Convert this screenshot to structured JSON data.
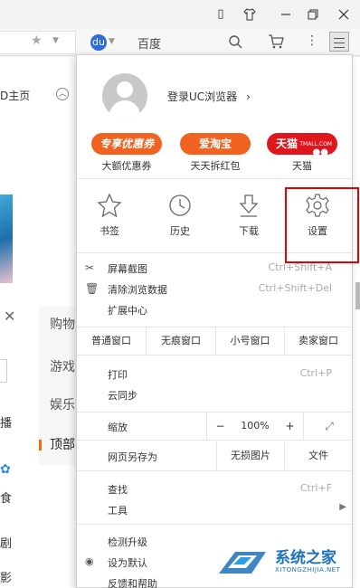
{
  "titlebar": {
    "icons": [
      "phone-icon",
      "shirt-icon",
      "minimize-icon",
      "restore-icon",
      "close-icon"
    ]
  },
  "toolbar": {
    "search_engine": "百度",
    "baidu_icon": "du",
    "icons": [
      "star-icon",
      "chevron-down-icon",
      "search-icon",
      "cart-icon",
      "more-icon",
      "menu-icon"
    ]
  },
  "background_page": {
    "home_link": "D主页",
    "side_items": [
      "购物",
      "游戏",
      "娱乐",
      "顶部"
    ],
    "left_texts": [
      "播",
      "食",
      "剧",
      "影"
    ]
  },
  "menu": {
    "login": "登录UC浏览器",
    "login_chevron": "›",
    "promos": [
      {
        "pill": "专享优惠券",
        "label": "大额优惠券",
        "color": "#f0621f"
      },
      {
        "pill": "爱淘宝",
        "label": "天天拆红包",
        "color": "#f0621f"
      },
      {
        "pill": "天猫",
        "label": "天猫",
        "color": "#e0161e"
      }
    ],
    "tmall_badge": "TMALL.COM",
    "tools": [
      {
        "label": "书签",
        "icon": "star-icon"
      },
      {
        "label": "历史",
        "icon": "clock-icon"
      },
      {
        "label": "下载",
        "icon": "download-icon"
      },
      {
        "label": "设置",
        "icon": "gear-icon"
      }
    ],
    "screenshot": {
      "label": "屏幕截图",
      "shortcut": "Ctrl+Shift+A"
    },
    "clear_data": {
      "label": "清除浏览数据",
      "shortcut": "Ctrl+Shift+Del"
    },
    "extensions": {
      "label": "扩展中心"
    },
    "window_modes": [
      "普通窗口",
      "无痕窗口",
      "小号窗口",
      "卖家窗口"
    ],
    "print": {
      "label": "打印",
      "shortcut": "Ctrl+P"
    },
    "cloud_sync": {
      "label": "云同步"
    },
    "zoom": {
      "label": "缩放",
      "minus": "−",
      "value": "100%",
      "plus": "+",
      "fullscreen": "⤢"
    },
    "save_page": {
      "label": "网页另存为",
      "lossless": "无损图片",
      "file": "文件"
    },
    "find": {
      "label": "查找",
      "shortcut": "Ctrl+F"
    },
    "tools_menu": {
      "label": "工具"
    },
    "check_update": {
      "label": "检测升级"
    },
    "set_default": {
      "label": "设为默认"
    },
    "feedback": {
      "label": "反馈和帮助"
    }
  },
  "watermark": {
    "text": "系统之家",
    "sub": "XITONGZHIJIA.NET"
  }
}
